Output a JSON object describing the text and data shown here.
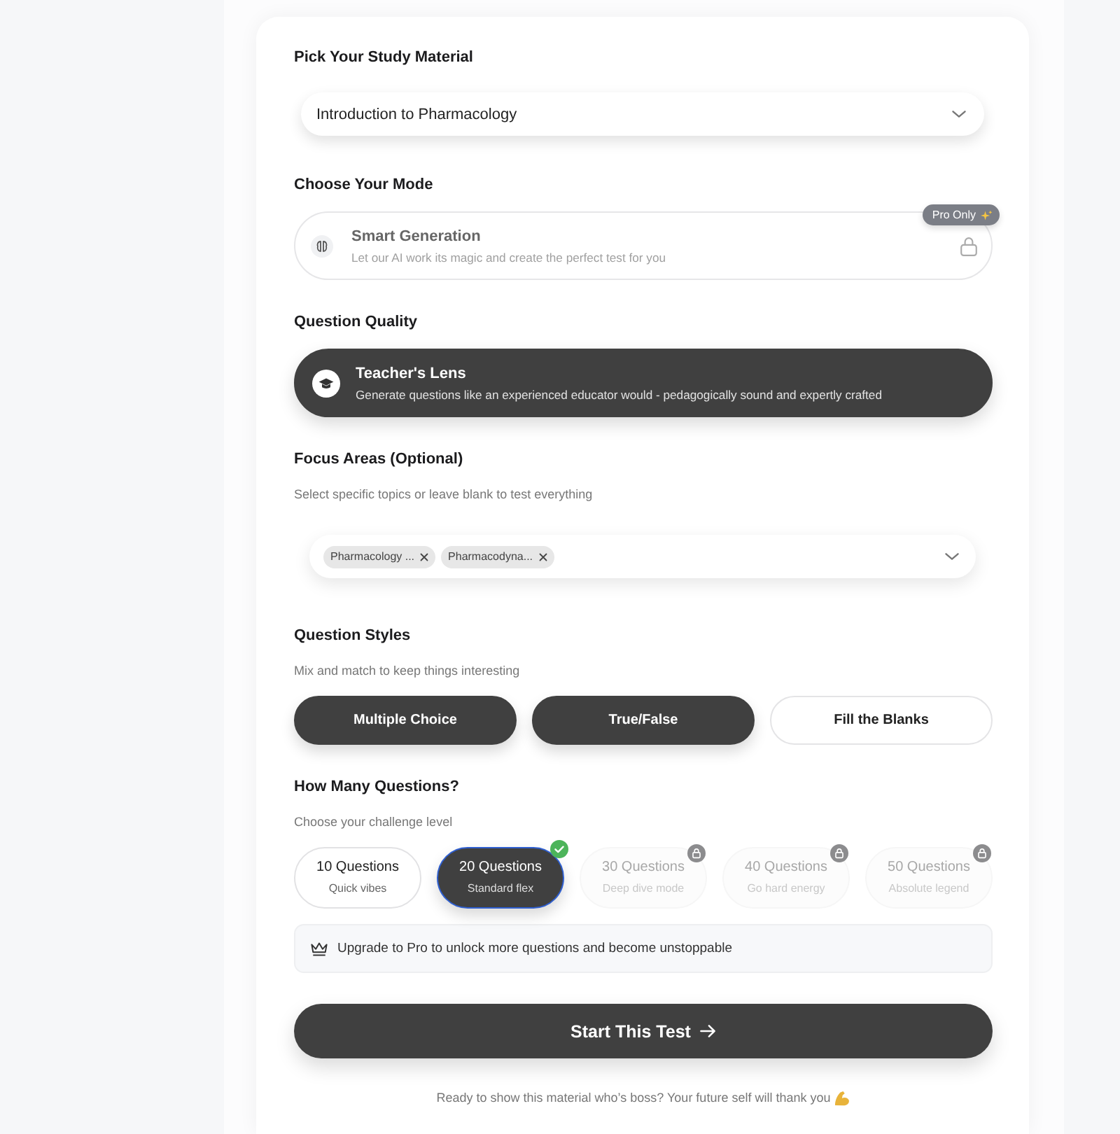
{
  "study_material": {
    "heading": "Pick Your Study Material",
    "select": {
      "value": "Introduction to Pharmacology"
    }
  },
  "mode": {
    "heading": "Choose Your Mode",
    "options": [
      {
        "title": "Smart Generation",
        "description": "Let our AI work its magic and create the perfect test for you",
        "badge": "Pro Only",
        "locked": true,
        "selected": false
      }
    ]
  },
  "quality": {
    "heading": "Question Quality",
    "options": [
      {
        "title": "Teacher's Lens",
        "description": "Generate questions like an experienced educator would - pedagogically sound and expertly crafted",
        "selected": true
      }
    ]
  },
  "focus_areas": {
    "heading": "Focus Areas (Optional)",
    "hint": "Select specific topics or leave blank to test everything",
    "chips": [
      {
        "label": "Pharmacology ..."
      },
      {
        "label": "Pharmacodyna..."
      }
    ]
  },
  "styles": {
    "heading": "Question Styles",
    "hint": "Mix and match to keep things interesting",
    "options": [
      {
        "label": "Multiple Choice",
        "selected": true
      },
      {
        "label": "True/False",
        "selected": true
      },
      {
        "label": "Fill the Blanks",
        "selected": false
      }
    ]
  },
  "count": {
    "heading": "How Many Questions?",
    "hint": "Choose your challenge level",
    "options": [
      {
        "title": "10 Questions",
        "subtitle": "Quick vibes",
        "selected": false,
        "locked": false
      },
      {
        "title": "20 Questions",
        "subtitle": "Standard flex",
        "selected": true,
        "locked": false
      },
      {
        "title": "30 Questions",
        "subtitle": "Deep dive mode",
        "selected": false,
        "locked": true
      },
      {
        "title": "40 Questions",
        "subtitle": "Go hard energy",
        "selected": false,
        "locked": true
      },
      {
        "title": "50 Questions",
        "subtitle": "Absolute legend",
        "selected": false,
        "locked": true
      }
    ]
  },
  "upgrade_banner": {
    "text": "Upgrade to Pro to unlock more questions and become unstoppable"
  },
  "start_button": {
    "label": "Start This Test"
  },
  "footer": {
    "text": "Ready to show this material who’s boss? Your future self will thank you"
  }
}
